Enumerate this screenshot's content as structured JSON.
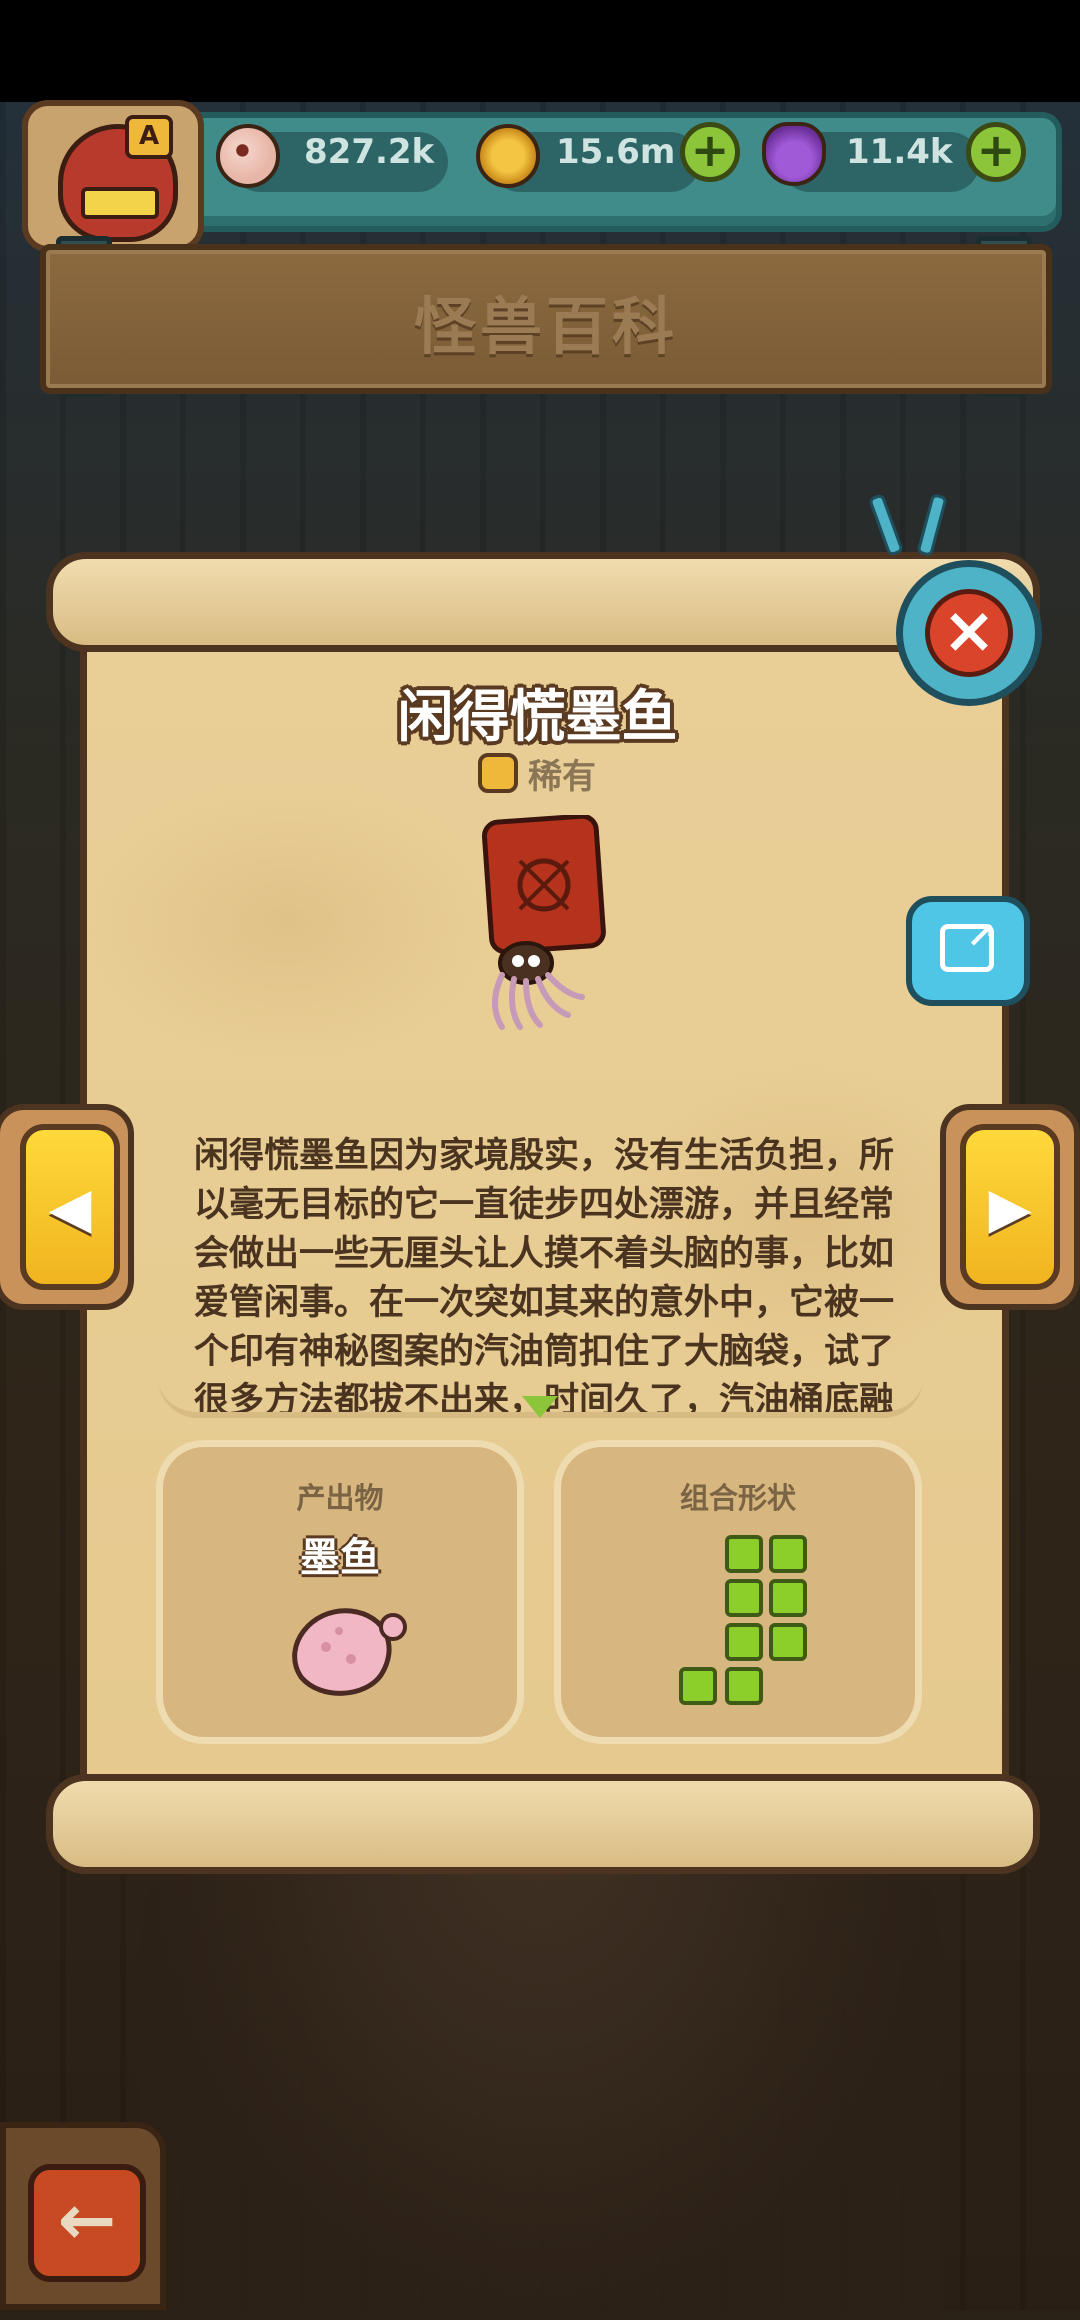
{
  "header": {
    "resources": [
      {
        "name": "eyeball",
        "value": "827.2k",
        "color": "#e8b6a8"
      },
      {
        "name": "gold-coin",
        "value": "15.6m",
        "color": "#e0a52a"
      },
      {
        "name": "potion",
        "value": "11.4k",
        "color": "#8c4cc4"
      }
    ],
    "avatar_badge": "A",
    "title": "怪兽百科"
  },
  "monster": {
    "name": "闲得慌墨鱼",
    "rarity": "稀有",
    "description": "闲得慌墨鱼因为家境殷实，没有生活负担，所以毫无目标的它一直徒步四处漂游，并且经常会做出一些无厘头让人摸不着头脑的事，比如爱管闲事。在一次突如其来的意外中，它被一个印有神秘图案的汽油筒扣住了大脑袋，试了很多方法都拔不出来，时间久了，汽油桶底融"
  },
  "output_panel": {
    "label": "产出物",
    "value": "墨鱼"
  },
  "shape_panel": {
    "label": "组合形状",
    "shape_color": "#8ccf2a"
  },
  "buttons": {
    "close": "×",
    "prev": "◀",
    "next": "▶",
    "back": "←"
  },
  "colors": {
    "teal": "#3f8c8a",
    "paper": "#e9cf97",
    "gold": "#ffd93a"
  }
}
